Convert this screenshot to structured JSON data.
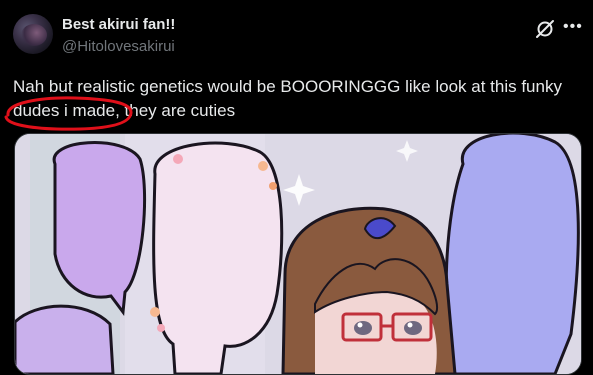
{
  "author": {
    "display_name": "Best akirui fan!!",
    "handle": "@Hitolovesakirui"
  },
  "tweet": {
    "text": "Nah but realistic genetics would be BOOORINGGG like look at this funky dudes i made, they are cuties"
  },
  "icons": {
    "grok": "grok-slash-icon",
    "more": "more-horizontal-icon"
  },
  "colors": {
    "background": "#000000",
    "text": "#e7e9ea",
    "muted": "#71767b",
    "annotation": "#e0101a"
  },
  "media": {
    "description_icon": "anime-illustration"
  }
}
